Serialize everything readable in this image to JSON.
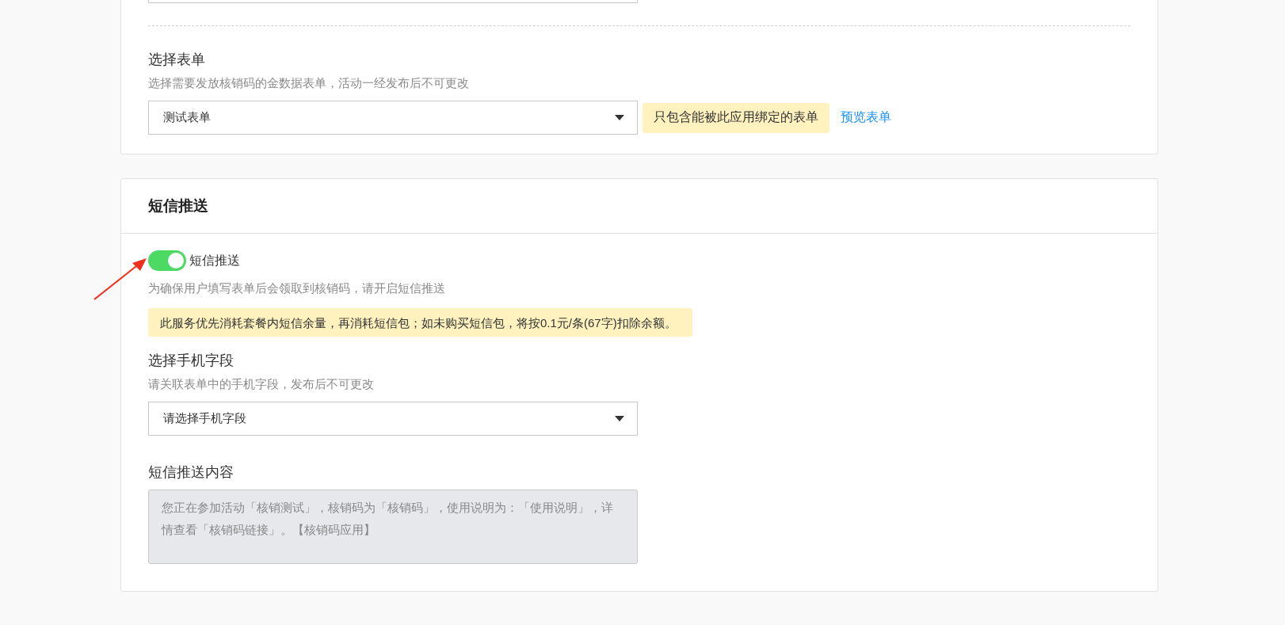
{
  "form_section": {
    "field": {
      "label": "选择表单",
      "hint": "选择需要发放核销码的金数据表单，活动一经发布后不可更改",
      "value": "测试表单",
      "tip": "只包含能被此应用绑定的表单",
      "link": "预览表单"
    }
  },
  "sms_section": {
    "title": "短信推送",
    "toggle": {
      "label": "短信推送",
      "on": true
    },
    "hint": "为确保用户填写表单后会领取到核销码，请开启短信推送",
    "notice": "此服务优先消耗套餐内短信余量，再消耗短信包；如未购买短信包，将按0.1元/条(67字)扣除余额。",
    "phone_field": {
      "label": "选择手机字段",
      "hint": "请关联表单中的手机字段，发布后不可更改",
      "placeholder": "请选择手机字段"
    },
    "content_field": {
      "label": "短信推送内容",
      "value": "您正在参加活动「核销测试」，核销码为「核销码」，使用说明为：「使用说明」，详情查看「核销码链接」。【核销码应用】",
      "disabled": true
    }
  }
}
